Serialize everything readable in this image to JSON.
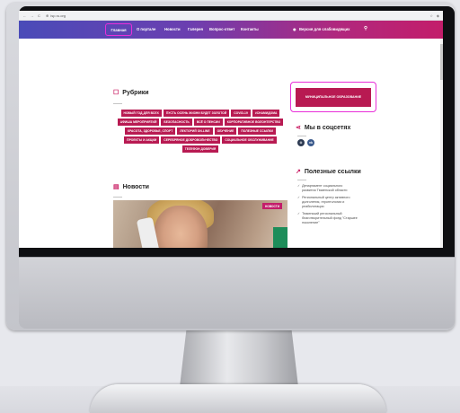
{
  "browser": {
    "url": "isp.ru.org",
    "back": "←",
    "forward": "→",
    "reload": "C",
    "lock": "⊕",
    "right_icons": [
      "☆",
      "◈"
    ]
  },
  "nav": {
    "home": "Главная",
    "about": "О портале",
    "news": "Новости",
    "gallery": "Галерея",
    "qa": "Вопрос-ответ",
    "contacts": "Контакты",
    "accessible": "Версия для слабовидящих",
    "eye_icon": "◉",
    "search_icon": "⚲"
  },
  "rubrics": {
    "title": "Рубрики",
    "tags": [
      "НОВЫЙ ГОД ДЛЯ ВСЕХ",
      "ПУСТЬ ОСЕНЬ ЖИЗНИ БУДЕТ ЗОЛОТОЙ",
      "COVID-19",
      "#СНАМИДОМА",
      "АФИША МЕРОПРИЯТИЙ",
      "БЕЗОПАСНОСТЬ",
      "ВСЁ О ПЕНСИИ",
      "КОРПОРАТИВНОЕ ВОЛОНТЕРСТВО",
      "КРАСОТА, ЗДОРОВЬЕ, СПОРТ",
      "ЛЕКТОРИЙ ON-LINE",
      "ОБУЧЕНИЕ",
      "ПОЛЕЗНЫЕ ССЫЛКИ",
      "ПРОЕКТЫ И АКЦИИ",
      "СЕРЕБРЯНОЕ ДОБРОВОЛЬЧЕСТВО",
      "СОЦИАЛЬНОЕ ОБСЛУЖИВАНИЕ",
      "ТЕЛЕФОН ДОВЕРИЯ"
    ]
  },
  "news": {
    "title": "Новости",
    "badge": "НОВОСТИ"
  },
  "municipal_button": "МУНИЦИПАЛЬНОЕ ОБРАЗОВАНИЕ",
  "social": {
    "title": "Мы в соцсетях",
    "icons": [
      {
        "name": "ok-icon",
        "glyph": "⊙"
      },
      {
        "name": "vk-icon",
        "glyph": "vk"
      }
    ]
  },
  "links": {
    "title": "Полезные ссылки",
    "items": [
      "Департамент социального\nразвития Тюменской области",
      "Региональный центр активного\nдолголетия, геронтологии и\nреабилитации",
      "Тюменский региональный\nблаготворительный фонд \"Старшее\nпоколение\""
    ],
    "check_glyph": "✓"
  },
  "colors": {
    "accent": "#b81a52",
    "highlight": "#e82fd9",
    "nav_start": "#4a4bb8",
    "nav_end": "#c31d6a"
  }
}
